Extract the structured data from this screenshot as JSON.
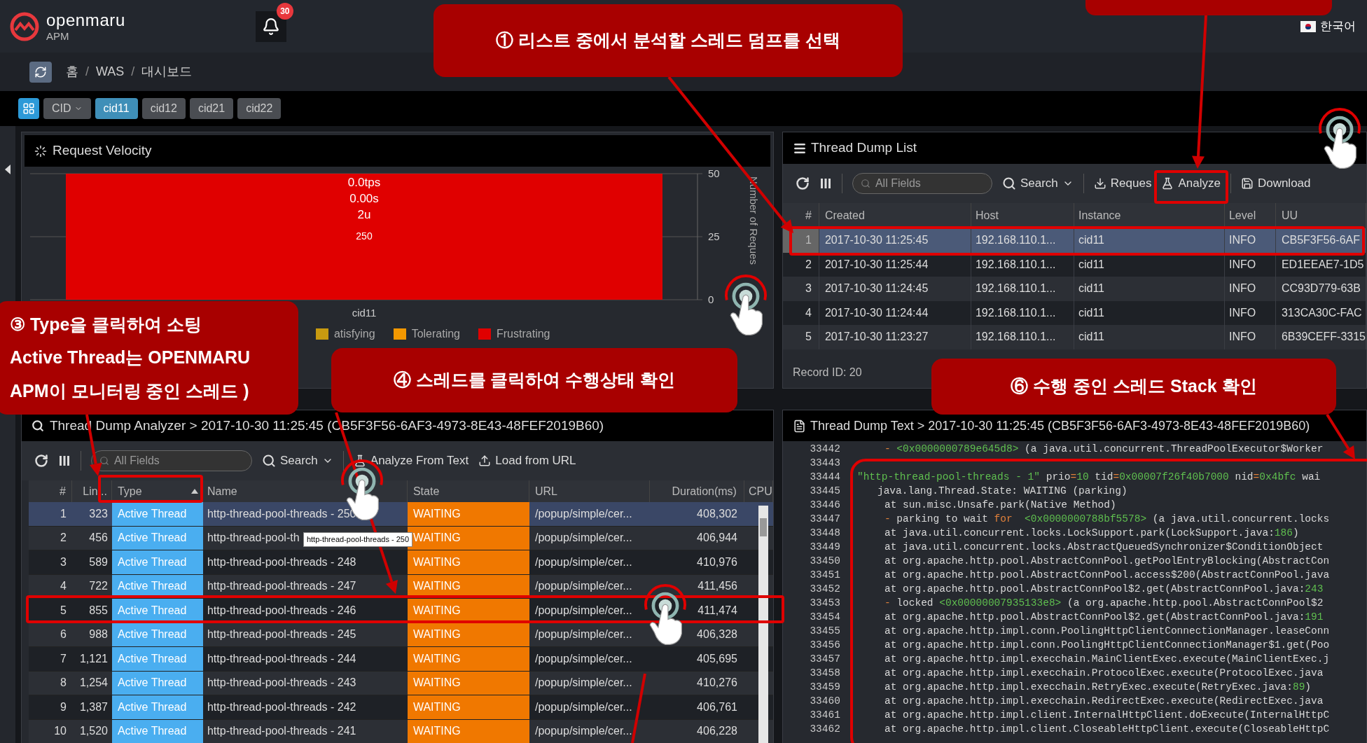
{
  "header": {
    "logo": "openmaru",
    "logo_sub": "APM",
    "notifications": "30",
    "language": "한국어"
  },
  "breadcrumb": {
    "items": [
      "홈",
      "WAS",
      "대시보드"
    ],
    "separator": "/"
  },
  "cid_tabs": [
    {
      "label": "CID",
      "kind": "dropdown",
      "selected": false
    },
    {
      "label": "cid11",
      "kind": "tab",
      "selected": true
    },
    {
      "label": "cid12",
      "kind": "tab",
      "selected": false
    },
    {
      "label": "cid21",
      "kind": "tab",
      "selected": false
    },
    {
      "label": "cid22",
      "kind": "tab",
      "selected": false
    }
  ],
  "velocity": {
    "title": "Request Velocity",
    "chart_data": {
      "type": "bar",
      "ylabel": "Number of Reques",
      "categories": [
        "cid11"
      ],
      "values": [
        50
      ],
      "ylim": [
        0,
        50
      ],
      "yticks": [
        0,
        25,
        50
      ]
    },
    "bar_labels": [
      "0.0tps",
      "0.00s",
      "2u",
      "250"
    ],
    "legend": [
      {
        "label": "atisfying",
        "color": "#c89a10"
      },
      {
        "label": "Tolerating",
        "color": "#f39800"
      },
      {
        "label": "Frustrating",
        "color": "#e00000"
      }
    ]
  },
  "dump_list": {
    "title": "Thread Dump List",
    "search_placeholder": "All Fields",
    "search": "Search",
    "buttons": [
      "Reques",
      "Analyze",
      "Download"
    ],
    "columns": [
      "#",
      "Created",
      "Host",
      "Instance",
      "Level",
      "UU"
    ],
    "rows": [
      {
        "cells": [
          "1",
          "2017-10-30 11:25:45",
          "192.168.110.1...",
          "cid11",
          "INFO",
          "CB5F3F56-6AF"
        ],
        "selected": true
      },
      {
        "cells": [
          "2",
          "2017-10-30 11:25:44",
          "192.168.110.1...",
          "cid11",
          "INFO",
          "ED1EEAE7-1D5"
        ],
        "selected": false
      },
      {
        "cells": [
          "3",
          "2017-10-30 11:24:45",
          "192.168.110.1...",
          "cid11",
          "INFO",
          "CC93D779-63B"
        ],
        "selected": false
      },
      {
        "cells": [
          "4",
          "2017-10-30 11:24:44",
          "192.168.110.1...",
          "cid11",
          "INFO",
          "313CA30C-FAC"
        ],
        "selected": false
      },
      {
        "cells": [
          "5",
          "2017-10-30 11:23:27",
          "192.168.110.1...",
          "cid11",
          "INFO",
          "6B39CEFF-3315"
        ],
        "selected": false
      }
    ],
    "record": "Record ID: 20"
  },
  "analyzer": {
    "title": "Thread Dump Analyzer > 2017-10-30 11:25:45 (CB5F3F56-6AF3-4973-8E43-48FEF2019B60)",
    "search_placeholder": "All Fields",
    "search": "Search",
    "buttons": [
      "Analyze From Text",
      "Load from URL"
    ],
    "columns": [
      {
        "label": "#",
        "sorted": false
      },
      {
        "label": "Lin...",
        "sorted": false
      },
      {
        "label": "Type",
        "sorted": true
      },
      {
        "label": "Name",
        "sorted": false
      },
      {
        "label": "State",
        "sorted": false
      },
      {
        "label": "URL",
        "sorted": false
      },
      {
        "label": "Duration(ms)",
        "sorted": false
      },
      {
        "label": "CPU",
        "sorted": false
      }
    ],
    "rows": [
      {
        "cells": [
          "1",
          "323",
          "Active Thread",
          "http-thread-pool-threads - 250",
          "WAITING",
          "/popup/simple/cer...",
          "408,302"
        ],
        "selected": true
      },
      {
        "cells": [
          "2",
          "456",
          "Active Thread",
          "http-thread-pool-th",
          "WAITING",
          "/popup/simple/cer...",
          "406,944"
        ],
        "selected": false
      },
      {
        "cells": [
          "3",
          "589",
          "Active Thread",
          "http-thread-pool-threads - 248",
          "WAITING",
          "/popup/simple/cer...",
          "410,976"
        ],
        "selected": false
      },
      {
        "cells": [
          "4",
          "722",
          "Active Thread",
          "http-thread-pool-threads - 247",
          "WAITING",
          "/popup/simple/cer...",
          "411,456"
        ],
        "selected": false
      },
      {
        "cells": [
          "5",
          "855",
          "Active Thread",
          "http-thread-pool-threads - 246",
          "WAITING",
          "/popup/simple/cer...",
          "411,474"
        ],
        "selected": false
      },
      {
        "cells": [
          "6",
          "988",
          "Active Thread",
          "http-thread-pool-threads - 245",
          "WAITING",
          "/popup/simple/cer...",
          "406,328"
        ],
        "selected": false
      },
      {
        "cells": [
          "7",
          "1,121",
          "Active Thread",
          "http-thread-pool-threads - 244",
          "WAITING",
          "/popup/simple/cer...",
          "405,695"
        ],
        "selected": false
      },
      {
        "cells": [
          "8",
          "1,254",
          "Active Thread",
          "http-thread-pool-threads - 243",
          "WAITING",
          "/popup/simple/cer...",
          "410,276"
        ],
        "selected": false
      },
      {
        "cells": [
          "9",
          "1,387",
          "Active Thread",
          "http-thread-pool-threads - 242",
          "WAITING",
          "/popup/simple/cer...",
          "406,761"
        ],
        "selected": false
      },
      {
        "cells": [
          "10",
          "1,520",
          "Active Thread",
          "http-thread-pool-threads - 241",
          "WAITING",
          "/popup/simple/cer...",
          "406,228"
        ],
        "selected": false
      }
    ],
    "tooltip": "http-thread-pool-threads - 250"
  },
  "dump_text": {
    "title": "Thread Dump Text > 2017-10-30 11:25:45 (CB5F3F56-6AF3-4973-8E43-48FEF2019B60)",
    "lines": [
      {
        "number": "33442",
        "kind": "frame",
        "segments": [
          {
            "text": "- ",
            "kind": "orange"
          },
          {
            "text": "<0x0000000789e645d8>",
            "kind": "green"
          },
          {
            "text": " (a java.util.concurrent.ThreadPoolExecutor$Worker",
            "kind": "plain"
          }
        ]
      },
      {
        "number": "33443",
        "kind": "blank"
      },
      {
        "number": "33444",
        "kind": "thread",
        "segments": [
          {
            "text": "\"http-thread-pool-threads - 1\"",
            "kind": "green"
          },
          {
            "text": " prio",
            "kind": "plain"
          },
          {
            "text": "=",
            "kind": "orange"
          },
          {
            "text": "10",
            "kind": "green"
          },
          {
            "text": " tid",
            "kind": "plain"
          },
          {
            "text": "=",
            "kind": "orange"
          },
          {
            "text": "0x00007f26f40b7000",
            "kind": "green"
          },
          {
            "text": " nid",
            "kind": "plain"
          },
          {
            "text": "=",
            "kind": "orange"
          },
          {
            "text": "0x4bfc",
            "kind": "green"
          },
          {
            "text": " wai",
            "kind": "plain"
          }
        ]
      },
      {
        "number": "33445",
        "kind": "state",
        "segments": [
          {
            "text": "java.lang.Thread.State: WAITING (parking)",
            "kind": "plain"
          }
        ]
      },
      {
        "number": "33446",
        "kind": "frame",
        "segments": [
          {
            "text": "at sun.misc.Unsafe.park(Native Method)",
            "kind": "plain"
          }
        ]
      },
      {
        "number": "33447",
        "kind": "frame",
        "segments": [
          {
            "text": "- ",
            "kind": "orange"
          },
          {
            "text": "parking to wait ",
            "kind": "plain"
          },
          {
            "text": "for",
            "kind": "orange"
          },
          {
            "text": "  <0x0000000788bf5578>",
            "kind": "green"
          },
          {
            "text": " (a java.util.concurrent.locks",
            "kind": "plain"
          }
        ]
      },
      {
        "number": "33448",
        "kind": "frame",
        "segments": [
          {
            "text": "at java.util.concurrent.locks.LockSupport.park(LockSupport.java:",
            "kind": "plain"
          },
          {
            "text": "186",
            "kind": "green"
          },
          {
            "text": ")",
            "kind": "plain"
          }
        ]
      },
      {
        "number": "33449",
        "kind": "frame",
        "segments": [
          {
            "text": "at java.util.concurrent.locks.AbstractQueuedSynchronizer$ConditionObject",
            "kind": "plain"
          }
        ]
      },
      {
        "number": "33450",
        "kind": "frame",
        "segments": [
          {
            "text": "at org.apache.http.pool.AbstractConnPool.getPoolEntryBlocking(AbstractCon",
            "kind": "plain"
          }
        ]
      },
      {
        "number": "33451",
        "kind": "frame",
        "segments": [
          {
            "text": "at org.apache.http.pool.AbstractConnPool.access$200(AbstractConnPool.java",
            "kind": "plain"
          }
        ]
      },
      {
        "number": "33452",
        "kind": "frame",
        "segments": [
          {
            "text": "at org.apache.http.pool.AbstractConnPool$2.get(AbstractConnPool.java:",
            "kind": "plain"
          },
          {
            "text": "243",
            "kind": "green"
          }
        ]
      },
      {
        "number": "33453",
        "kind": "frame",
        "segments": [
          {
            "text": "- ",
            "kind": "orange"
          },
          {
            "text": "locked ",
            "kind": "plain"
          },
          {
            "text": "<0x00000007935133e8>",
            "kind": "green"
          },
          {
            "text": " (a org.apache.http.pool.AbstractConnPool$2",
            "kind": "plain"
          }
        ]
      },
      {
        "number": "33454",
        "kind": "frame",
        "segments": [
          {
            "text": "at org.apache.http.pool.AbstractConnPool$2.get(AbstractConnPool.java:",
            "kind": "plain"
          },
          {
            "text": "191",
            "kind": "green"
          }
        ]
      },
      {
        "number": "33455",
        "kind": "frame",
        "segments": [
          {
            "text": "at org.apache.http.impl.conn.PoolingHttpClientConnectionManager.leaseConn",
            "kind": "plain"
          }
        ]
      },
      {
        "number": "33456",
        "kind": "frame",
        "segments": [
          {
            "text": "at org.apache.http.impl.conn.PoolingHttpClientConnectionManager$1.get(Poo",
            "kind": "plain"
          }
        ]
      },
      {
        "number": "33457",
        "kind": "frame",
        "segments": [
          {
            "text": "at org.apache.http.impl.execchain.MainClientExec.execute(MainClientExec.j",
            "kind": "plain"
          }
        ]
      },
      {
        "number": "33458",
        "kind": "frame",
        "segments": [
          {
            "text": "at org.apache.http.impl.execchain.ProtocolExec.execute(ProtocolExec.java",
            "kind": "plain"
          }
        ]
      },
      {
        "number": "33459",
        "kind": "frame",
        "segments": [
          {
            "text": "at org.apache.http.impl.execchain.RetryExec.execute(RetryExec.java:",
            "kind": "plain"
          },
          {
            "text": "89",
            "kind": "green"
          },
          {
            "text": ")",
            "kind": "plain"
          }
        ]
      },
      {
        "number": "33460",
        "kind": "frame",
        "segments": [
          {
            "text": "at org.apache.http.impl.execchain.RedirectExec.execute(RedirectExec.java",
            "kind": "plain"
          }
        ]
      },
      {
        "number": "33461",
        "kind": "frame",
        "segments": [
          {
            "text": "at org.apache.http.impl.client.InternalHttpClient.doExecute(InternalHttpC",
            "kind": "plain"
          }
        ]
      },
      {
        "number": "33462",
        "kind": "frame",
        "segments": [
          {
            "text": "at org.apache.http.impl.client.CloseableHttpClient.execute(CloseableHttpC",
            "kind": "plain"
          }
        ]
      }
    ]
  },
  "callouts": [
    {
      "lines": [
        "① 리스트 중에서 분석할 스레드 덤프를 선택"
      ]
    },
    {
      "lines": [
        "③ Type을 클릭하여 소팅",
        "Active Thread는 OPENMARU",
        "APM이 모니터링 중인 스레드 )"
      ]
    },
    {
      "lines": [
        "④ 스레드를 클릭하여 수행상태 확인"
      ]
    },
    {
      "lines": [
        "⑥ 수행 중인 스레드 Stack 확인"
      ]
    }
  ]
}
